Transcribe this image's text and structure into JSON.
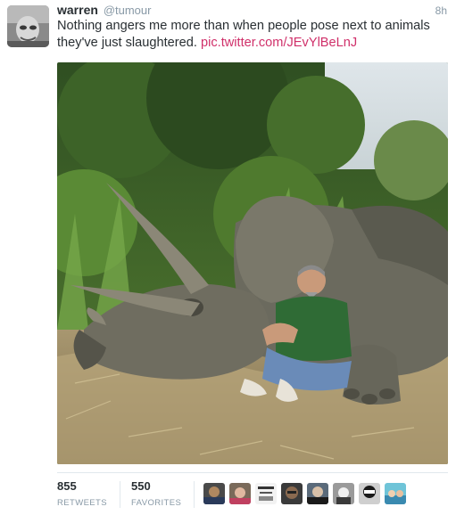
{
  "tweet": {
    "name": "warren",
    "handle": "@tumour",
    "time": "8h",
    "text": "Nothing angers me more than when people pose next to animals they've just slaughtered.",
    "link": "pic.twitter.com/JEvYlBeLnJ"
  },
  "stats": {
    "retweets_count": "855",
    "retweets_label": "RETWEETS",
    "favorites_count": "550",
    "favorites_label": "FAVORITES"
  },
  "favoriters": [
    "avatar-1",
    "avatar-2",
    "avatar-3",
    "avatar-4",
    "avatar-5",
    "avatar-6",
    "avatar-7",
    "avatar-8"
  ],
  "colors": {
    "link": "#d0306a",
    "muted": "#8899a6",
    "text": "#292f33"
  }
}
